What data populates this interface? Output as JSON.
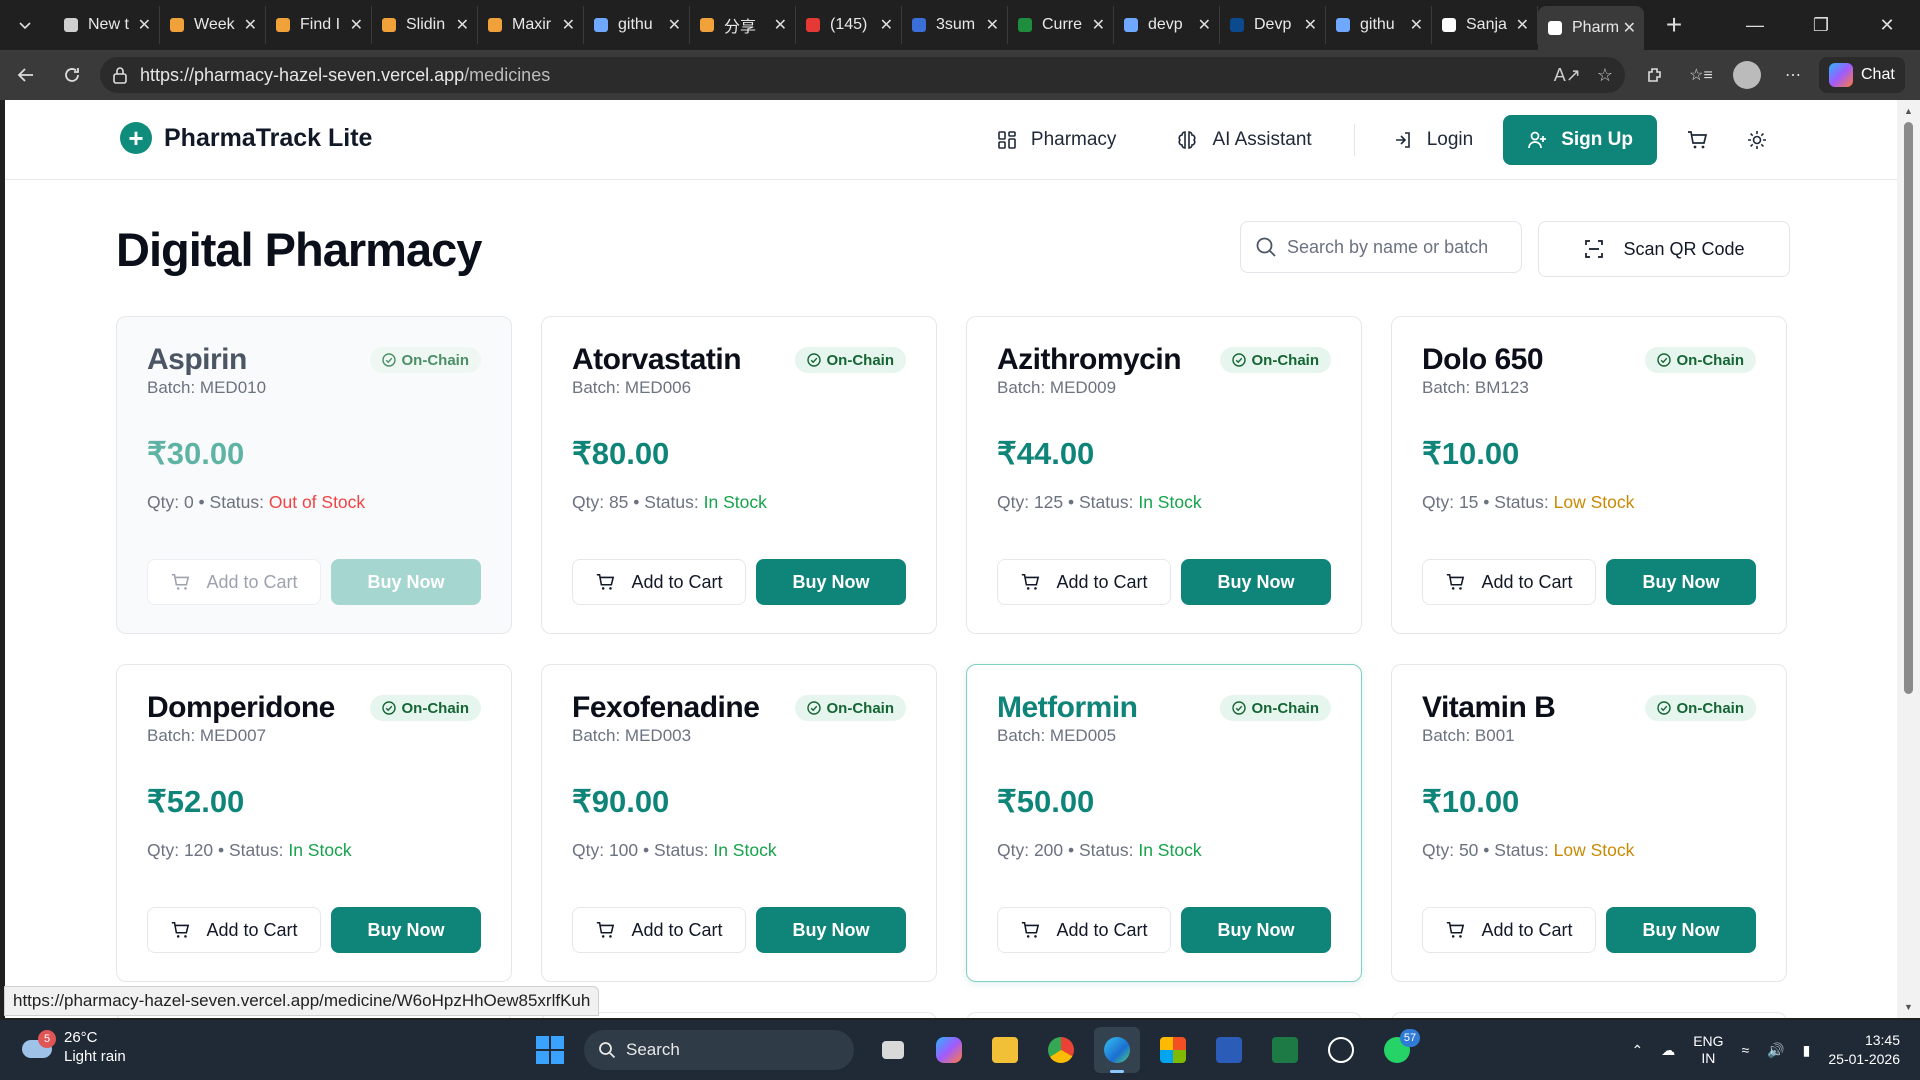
{
  "browser": {
    "tabs": [
      {
        "label": "New t",
        "icon": "newtab-icon",
        "color": "#cfcfcf"
      },
      {
        "label": "Week",
        "icon": "leetcode-icon",
        "color": "#f0a13a"
      },
      {
        "label": "Find I",
        "icon": "leetcode-icon",
        "color": "#f0a13a"
      },
      {
        "label": "Slidin",
        "icon": "leetcode-icon",
        "color": "#f0a13a"
      },
      {
        "label": "Maxir",
        "icon": "leetcode-icon",
        "color": "#f0a13a"
      },
      {
        "label": "githu",
        "icon": "search-icon",
        "color": "#6fa8ff"
      },
      {
        "label": "分享",
        "icon": "leetcode-icon",
        "color": "#f0a13a"
      },
      {
        "label": "(145)",
        "icon": "youtube-icon",
        "color": "#e53935"
      },
      {
        "label": "3sum",
        "icon": "chat-icon",
        "color": "#3b6fd8"
      },
      {
        "label": "Curre",
        "icon": "sheet-icon",
        "color": "#1e8e3e"
      },
      {
        "label": "devp",
        "icon": "search-icon",
        "color": "#6fa8ff"
      },
      {
        "label": "Devp",
        "icon": "devpost-icon",
        "color": "#0b4a8c"
      },
      {
        "label": "githu",
        "icon": "search-icon",
        "color": "#6fa8ff"
      },
      {
        "label": "Sanja",
        "icon": "github-icon",
        "color": "#ffffff"
      },
      {
        "label": "Pharm",
        "icon": "globe-icon",
        "color": "#ffffff",
        "active": true
      }
    ],
    "url_host": "https://pharmacy-hazel-seven.vercel.app",
    "url_path": "/medicines",
    "chat_label": "Chat",
    "status_url": "https://pharmacy-hazel-seven.vercel.app/medicine/W6oHpzHhOew85xrlfKuh"
  },
  "site": {
    "brand": "PharmaTrack Lite",
    "nav": {
      "pharmacy": "Pharmacy",
      "assistant": "AI Assistant",
      "login": "Login",
      "signup": "Sign Up"
    },
    "title": "Digital Pharmacy",
    "search_placeholder": "Search by name or batch",
    "scan_label": "Scan QR Code",
    "badge_label": "On-Chain",
    "cart_label": "Add to Cart",
    "buy_label": "Buy Now",
    "colors": {
      "accent": "#0f8478",
      "in_stock": "#16a34a",
      "low_stock": "#ca8a04",
      "out_of_stock": "#ef4444"
    }
  },
  "medicines": [
    {
      "name": "Aspirin",
      "batch": "Batch: MED010",
      "price": "₹30.00",
      "qty": "Qty: 0",
      "status": "Out of Stock",
      "status_class": "st-out",
      "variant": "oos"
    },
    {
      "name": "Atorvastatin",
      "batch": "Batch: MED006",
      "price": "₹80.00",
      "qty": "Qty: 85",
      "status": "In Stock",
      "status_class": "st-in",
      "variant": ""
    },
    {
      "name": "Azithromycin",
      "batch": "Batch: MED009",
      "price": "₹44.00",
      "qty": "Qty: 125",
      "status": "In Stock",
      "status_class": "st-in",
      "variant": ""
    },
    {
      "name": "Dolo 650",
      "batch": "Batch: BM123",
      "price": "₹10.00",
      "qty": "Qty: 15",
      "status": "Low Stock",
      "status_class": "st-low",
      "variant": ""
    },
    {
      "name": "Domperidone",
      "batch": "Batch: MED007",
      "price": "₹52.00",
      "qty": "Qty: 120",
      "status": "In Stock",
      "status_class": "st-in",
      "variant": ""
    },
    {
      "name": "Fexofenadine",
      "batch": "Batch: MED003",
      "price": "₹90.00",
      "qty": "Qty: 100",
      "status": "In Stock",
      "status_class": "st-in",
      "variant": ""
    },
    {
      "name": "Metformin",
      "batch": "Batch: MED005",
      "price": "₹50.00",
      "qty": "Qty: 200",
      "status": "In Stock",
      "status_class": "st-in",
      "variant": "hl"
    },
    {
      "name": "Vitamin B",
      "batch": "Batch: B001",
      "price": "₹10.00",
      "qty": "Qty: 50",
      "status": "Low Stock",
      "status_class": "st-low",
      "variant": ""
    }
  ],
  "taskbar": {
    "temp": "26°C",
    "weather": "Light rain",
    "weather_badge": "5",
    "search_label": "Search",
    "whatsapp_badge": "57",
    "lang_top": "ENG",
    "lang_bottom": "IN",
    "time": "13:45",
    "date": "25-01-2026"
  }
}
